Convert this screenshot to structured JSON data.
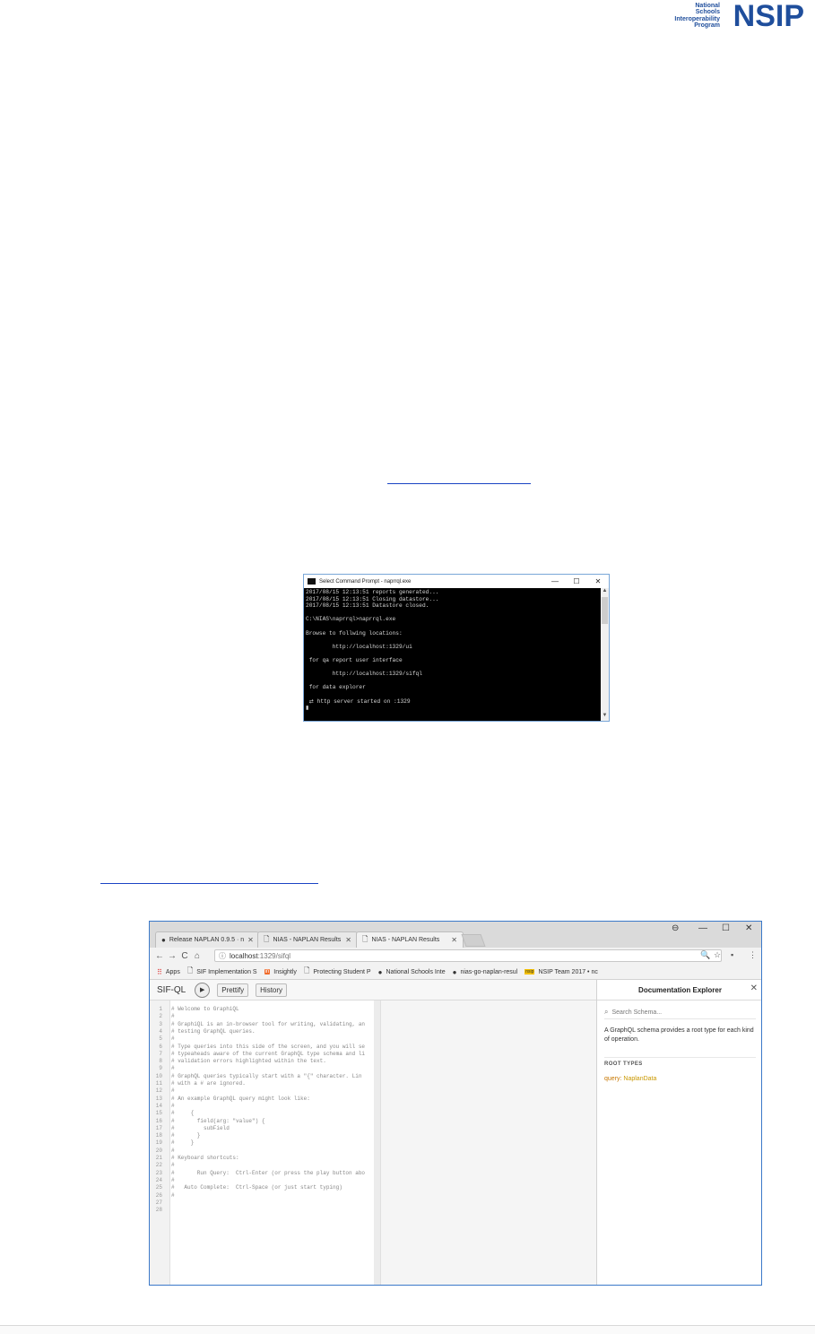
{
  "logo": {
    "small_lines": [
      "National",
      "Schools",
      "Interoperability",
      "Program"
    ],
    "big": "NSIP"
  },
  "cmd": {
    "title": "Select Command Prompt - naprrql.exe",
    "controls": [
      "—",
      "☐",
      "✕"
    ],
    "lines": [
      "2017/08/15 12:13:51 reports generated...",
      "2017/08/15 12:13:51 Closing datastore...",
      "2017/08/15 12:13:51 Datastore closed.",
      "",
      "C:\\NIAS\\naprrql>naprrql.exe",
      "",
      "Browse to follwing locations:",
      "",
      "        http://localhost:1329/ui",
      "",
      " for qa report user interface",
      "",
      "        http://localhost:1329/sifql",
      "",
      " for data explorer",
      "",
      " ⇄ http server started on :1329",
      "▮"
    ]
  },
  "browser": {
    "tabs": [
      {
        "icon": "●",
        "label": "Release NAPLAN 0.9.5 · n",
        "close": "✕"
      },
      {
        "icon": "🗋",
        "label": "NIAS - NAPLAN Results",
        "close": "✕"
      },
      {
        "icon": "🗋",
        "label": "NIAS - NAPLAN Results",
        "close": "✕"
      }
    ],
    "window_controls": [
      "⊖",
      "—",
      "☐",
      "✕"
    ],
    "nav": [
      "←",
      "→",
      "C",
      "⌂"
    ],
    "url_host": "localhost",
    "url_path": ":1329/sifql",
    "addr_right": [
      "🔍",
      "☆",
      "▪",
      "⋮"
    ],
    "bookmarks": [
      {
        "icon": "⠿",
        "label": "Apps"
      },
      {
        "icon": "🗋",
        "label": "SIF Implementation S"
      },
      {
        "icon": "in",
        "label": "Insightly"
      },
      {
        "icon": "🗋",
        "label": "Protecting Student P"
      },
      {
        "icon": "●",
        "label": "National Schools Inte"
      },
      {
        "icon": "●",
        "label": "nias-go-naplan-resul"
      },
      {
        "icon": "nsip",
        "label": "NSIP Team 2017 • nc"
      }
    ],
    "graphiql": {
      "title": "SIF-QL",
      "play": "▶",
      "prettify": "Prettify",
      "history": "History",
      "editor_lines": [
        "# Welcome to GraphiQL",
        "#",
        "# GraphiQL is an in-browser tool for writing, validating, an",
        "# testing GraphQL queries.",
        "#",
        "# Type queries into this side of the screen, and you will se",
        "# typeaheads aware of the current GraphQL type schema and li",
        "# validation errors highlighted within the text.",
        "#",
        "# GraphQL queries typically start with a \"{\" character. Lin",
        "# with a # are ignored.",
        "#",
        "# An example GraphQL query might look like:",
        "#",
        "#     {",
        "#       field(arg: \"value\") {",
        "#         subField",
        "#       }",
        "#     }",
        "#",
        "# Keyboard shortcuts:",
        "#",
        "#       Run Query:  Ctrl-Enter (or press the play button abo",
        "#",
        "#   Auto Complete:  Ctrl-Space (or just start typing)",
        "#",
        "",
        ""
      ],
      "docs": {
        "title": "Documentation Explorer",
        "close": "✕",
        "search_placeholder": "Search Schema...",
        "description": "A GraphQL schema provides a root type for each kind of operation.",
        "root_types_label": "ROOT TYPES",
        "query_field": "query",
        "query_type": "NaplanData"
      }
    }
  }
}
